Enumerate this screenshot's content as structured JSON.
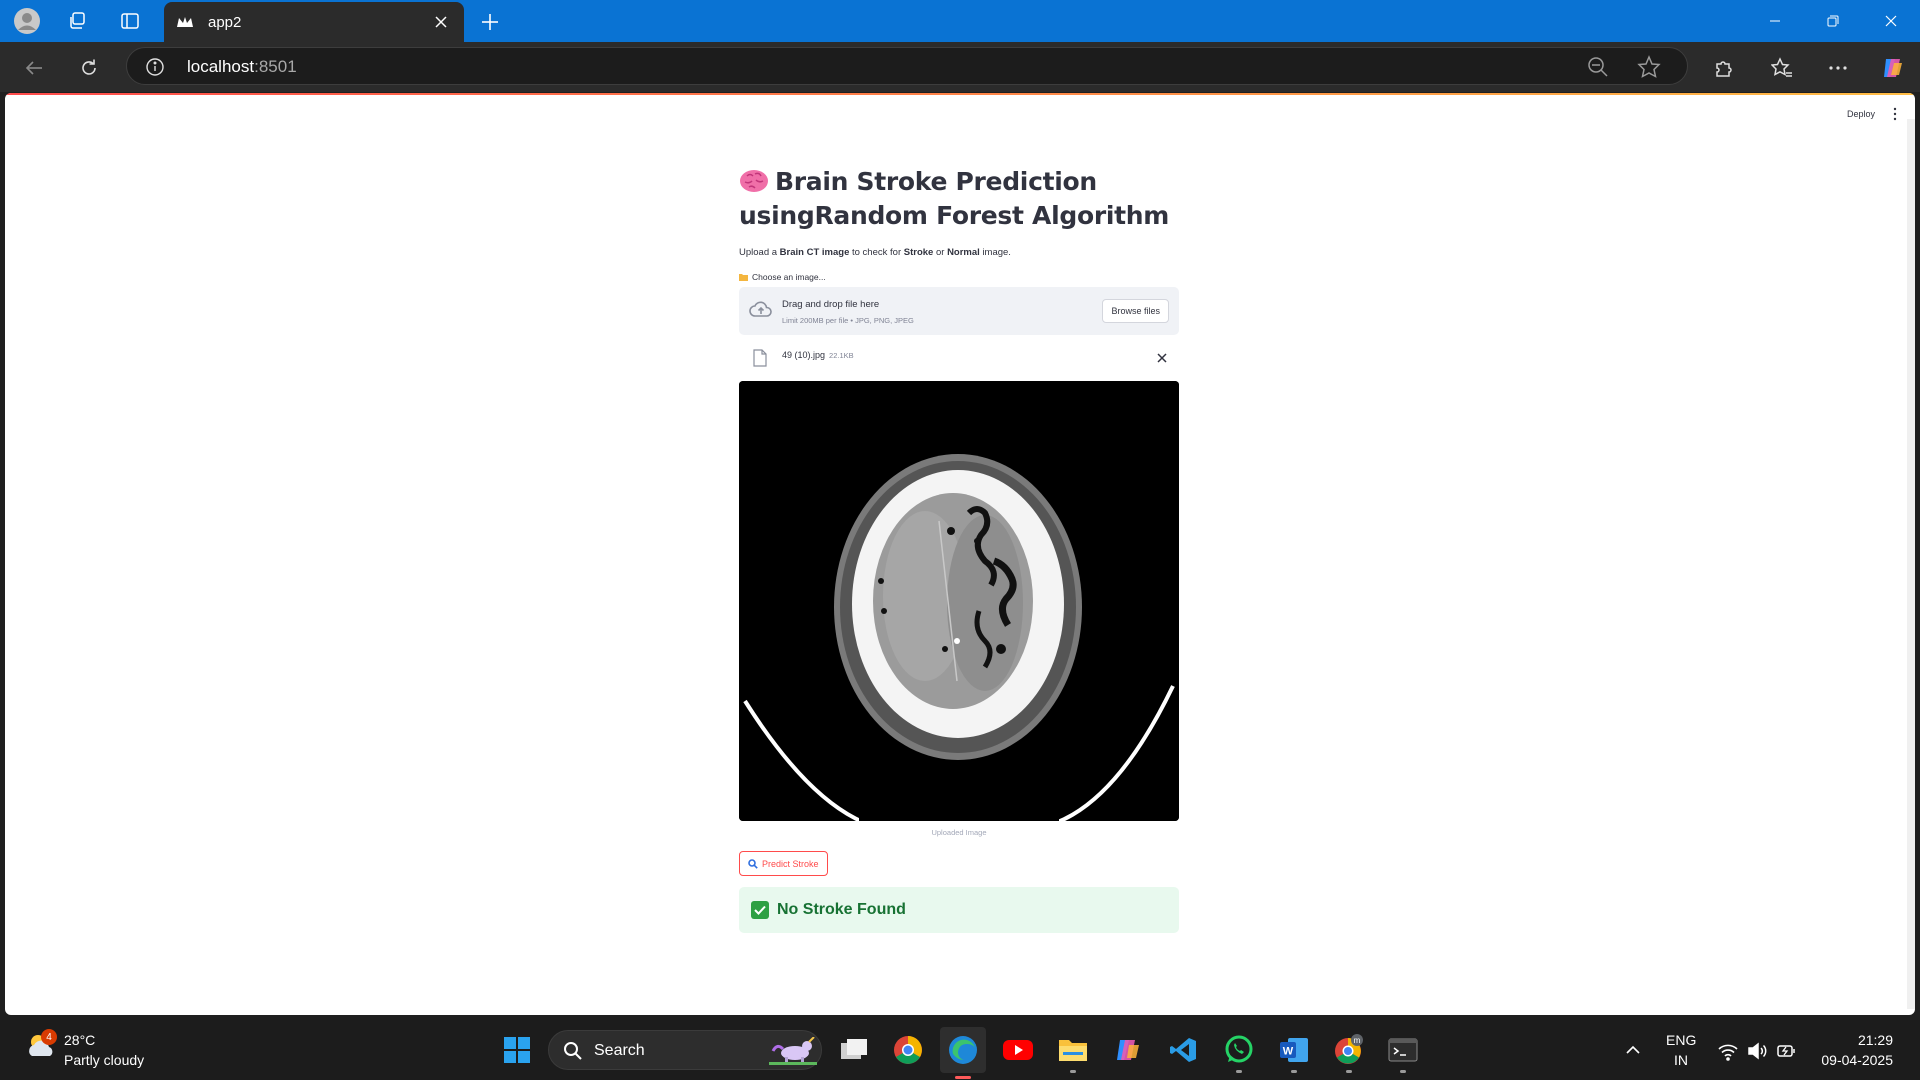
{
  "browser": {
    "tab_title": "app2",
    "url_host": "localhost",
    "url_port": ":8501"
  },
  "app": {
    "deploy_label": "Deploy",
    "title_line1": "Brain Stroke Prediction",
    "title_line2": "usingRandom Forest Algorithm",
    "description": {
      "p1": "Upload a ",
      "b1": "Brain CT image",
      "p2": " to check for ",
      "b2": "Stroke",
      "p3": " or ",
      "b3": "Normal",
      "p4": " image."
    },
    "uploader": {
      "label": "Choose an image...",
      "drop_title": "Drag and drop file here",
      "drop_limit": "Limit 200MB per file • JPG, PNG, JPEG",
      "browse_label": "Browse files",
      "file_name": "49 (10).jpg",
      "file_size": "22.1KB"
    },
    "image_caption": "Uploaded Image",
    "predict_label": "Predict Stroke",
    "result_text": "No Stroke Found",
    "colors": {
      "primary": "#ff4b4b",
      "success_bg": "#e8f9ee",
      "success_text": "#177233"
    }
  },
  "taskbar": {
    "weather_badge": "4",
    "temperature": "28°C",
    "condition": "Partly cloudy",
    "search_label": "Search",
    "lang_top": "ENG",
    "lang_bottom": "IN",
    "time": "21:29",
    "date": "09-04-2025"
  }
}
